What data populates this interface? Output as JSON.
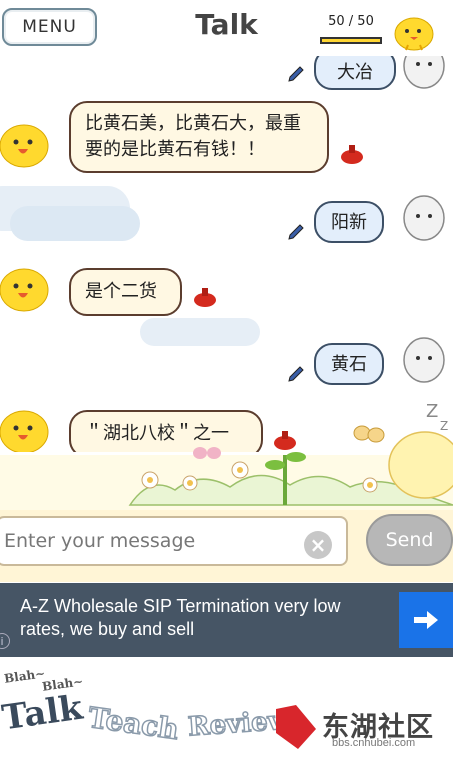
{
  "header": {
    "menu_label": "MENU",
    "title": "Talk",
    "counter_text": "50 / 50",
    "counter_fraction": 1.0
  },
  "messages": [
    {
      "side": "right",
      "text": "大冶"
    },
    {
      "side": "left",
      "text": "比黄石美，比黄石大，最重要的是比黄石有钱！！"
    },
    {
      "side": "right",
      "text": "阳新"
    },
    {
      "side": "left",
      "text": "是个二货"
    },
    {
      "side": "right",
      "text": "黄石"
    },
    {
      "side": "left",
      "text": "＂湖北八校＂之一"
    }
  ],
  "composer": {
    "placeholder": "Enter your message",
    "clear_symbol": "×",
    "send_label": "Send"
  },
  "ad": {
    "text": "A-Z Wholesale SIP Termination very low rates, we buy and sell",
    "info_symbol": "i"
  },
  "bottom_nav": {
    "blah1": "Blah~",
    "blah2": "Blah~",
    "talk": "Talk",
    "teach": "Teach",
    "review": "Review"
  },
  "watermark": {
    "title": "东湖社区",
    "url": "bbs.cnhubei.com"
  },
  "colors": {
    "left_bubble": "#fff8e3",
    "right_bubble": "#e3eefb",
    "ad_background": "#465565",
    "ad_arrow": "#1a73e8",
    "send_button": "#b7b7b7"
  }
}
